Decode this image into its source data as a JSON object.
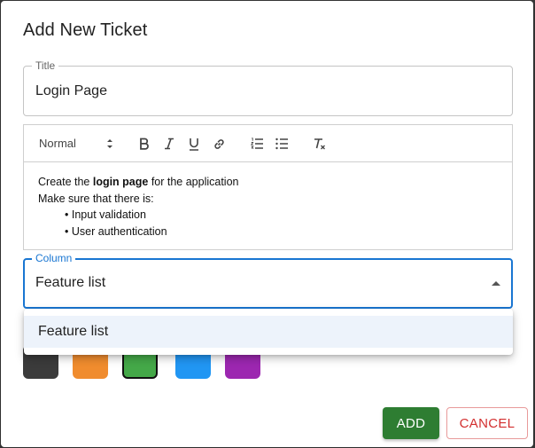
{
  "dialog": {
    "title": "Add New Ticket",
    "title_field": {
      "label": "Title",
      "value": "Login Page"
    },
    "editor": {
      "header_select": "Normal",
      "toolbar_icons": [
        "bold-icon",
        "italic-icon",
        "underline-icon",
        "link-icon",
        "ordered-list-icon",
        "bullet-list-icon",
        "clear-format-icon"
      ],
      "content": {
        "line1_prefix": "Create the ",
        "line1_bold": "login page",
        "line1_suffix": " for the application",
        "line2": "Make sure that there is:",
        "bullets": [
          "Input validation",
          "User authentication"
        ]
      }
    },
    "column_field": {
      "label": "Column",
      "value": "Feature list",
      "options": [
        "Feature list"
      ]
    },
    "colors": [
      {
        "hex": "#3b3b3b",
        "selected": false
      },
      {
        "hex": "#f08c2e",
        "selected": false
      },
      {
        "hex": "#44a848",
        "selected": true
      },
      {
        "hex": "#2196f3",
        "selected": false
      },
      {
        "hex": "#9c27b0",
        "selected": false
      }
    ],
    "buttons": {
      "add": "ADD",
      "cancel": "CANCEL"
    }
  }
}
